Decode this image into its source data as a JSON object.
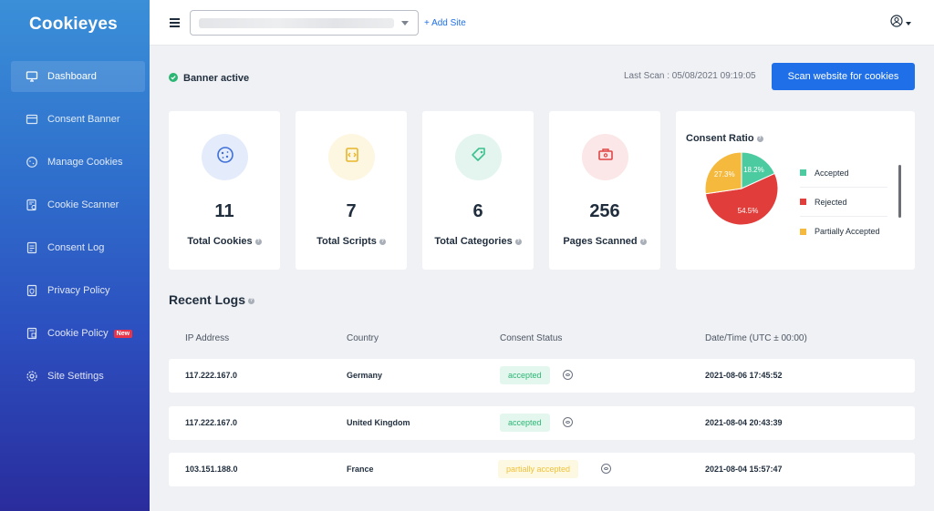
{
  "app": {
    "logo": "Cookieyes"
  },
  "sidebar": {
    "items": [
      {
        "label": "Dashboard",
        "icon": "monitor-icon",
        "active": true
      },
      {
        "label": "Consent Banner",
        "icon": "banner-icon"
      },
      {
        "label": "Manage Cookies",
        "icon": "cookie-icon"
      },
      {
        "label": "Cookie Scanner",
        "icon": "scanner-icon"
      },
      {
        "label": "Consent Log",
        "icon": "log-icon"
      },
      {
        "label": "Privacy Policy",
        "icon": "policy-icon"
      },
      {
        "label": "Cookie Policy",
        "icon": "document-icon",
        "badge": "New"
      },
      {
        "label": "Site Settings",
        "icon": "gear-icon"
      }
    ]
  },
  "header": {
    "add_site": "+ Add Site"
  },
  "status": {
    "text": "Banner active",
    "last_scan": "Last Scan : 05/08/2021 09:19:05",
    "scan_button": "Scan website for cookies"
  },
  "stats": [
    {
      "value": "11",
      "label": "Total Cookies",
      "icon": "cookie-icon",
      "color": "#e4ecfb"
    },
    {
      "value": "7",
      "label": "Total Scripts",
      "icon": "script-icon",
      "color": "#fdf6e0"
    },
    {
      "value": "6",
      "label": "Total Categories",
      "icon": "tag-icon",
      "color": "#e3f5ee"
    },
    {
      "value": "256",
      "label": "Pages Scanned",
      "icon": "page-scan-icon",
      "color": "#fbe7e7"
    }
  ],
  "consent": {
    "title": "Consent Ratio",
    "legend": [
      {
        "label": "Accepted",
        "color": "#4ccaa0"
      },
      {
        "label": "Rejected",
        "color": "#e13d3a"
      },
      {
        "label": "Partially Accepted",
        "color": "#f5b93d"
      }
    ]
  },
  "chart_data": {
    "type": "pie",
    "title": "Consent Ratio",
    "labels": [
      "Accepted",
      "Rejected",
      "Partially Accepted"
    ],
    "values": [
      18.2,
      54.5,
      27.3
    ],
    "value_labels": [
      "18.2%",
      "54.5%",
      "27.3%"
    ],
    "colors": [
      "#4ccaa0",
      "#e13d3a",
      "#f5b93d"
    ],
    "legend": "right"
  },
  "logs": {
    "title": "Recent Logs",
    "columns": [
      "IP Address",
      "Country",
      "Consent Status",
      "Date/Time (UTC ± 00:00)"
    ],
    "rows": [
      {
        "ip": "117.222.167.0",
        "country": "Germany",
        "status": "accepted",
        "datetime": "2021-08-06 17:45:52"
      },
      {
        "ip": "117.222.167.0",
        "country": "United Kingdom",
        "status": "accepted",
        "datetime": "2021-08-04 20:43:39"
      },
      {
        "ip": "103.151.188.0",
        "country": "France",
        "status": "partially accepted",
        "datetime": "2021-08-04 15:57:47"
      }
    ]
  }
}
